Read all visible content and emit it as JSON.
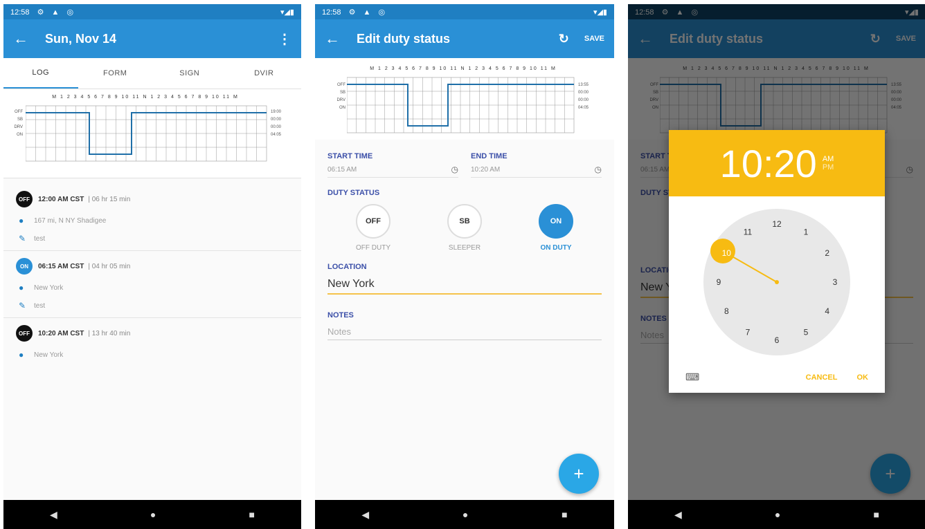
{
  "status_bar": {
    "time": "12:58",
    "icons_left": [
      "⚙",
      "▲",
      "◎"
    ],
    "icons_right": "▾◢▮"
  },
  "screen1": {
    "title": "Sun, Nov 14",
    "tabs": [
      {
        "label": "LOG",
        "active": true
      },
      {
        "label": "FORM",
        "active": false
      },
      {
        "label": "SIGN",
        "active": false
      },
      {
        "label": "DVIR",
        "active": false
      }
    ],
    "grid": {
      "hours": "M 1 2 3 4 5 6 7 8 9 10 11 N 1 2 3 4 5 6 7 8 9 10 11 M",
      "rows": [
        "OFF",
        "SB",
        "DRV",
        "ON"
      ],
      "totals": [
        "19:00",
        "00:00",
        "00:00",
        "04:05"
      ]
    },
    "entries": [
      {
        "status": "OFF",
        "time": "12:00 AM CST",
        "duration": "| 06 hr 15 min",
        "location": "167 mi, N NY Shadigee",
        "note": "test"
      },
      {
        "status": "ON",
        "time": "06:15 AM CST",
        "duration": "| 04 hr 05 min",
        "location": "New York",
        "note": "test"
      },
      {
        "status": "OFF",
        "time": "10:20 AM CST",
        "duration": "| 13 hr 40 min",
        "location": "New York",
        "note": ""
      }
    ]
  },
  "screen2": {
    "title": "Edit duty status",
    "save_label": "SAVE",
    "grid": {
      "hours": "M 1 2 3 4 5 6 7 8 9 10 11 N 1 2 3 4 5 6 7 8 9 10 11 M",
      "rows": [
        "OFF",
        "SB",
        "DRV",
        "ON"
      ],
      "totals": [
        "13:55",
        "00:00",
        "00:00",
        "04:05"
      ]
    },
    "start_time_label": "START TIME",
    "start_time_value": "06:15 AM",
    "end_time_label": "END TIME",
    "end_time_value": "10:20 AM",
    "duty_status_label": "DUTY STATUS",
    "duty_options": [
      {
        "code": "OFF",
        "label": "OFF DUTY",
        "selected": false
      },
      {
        "code": "SB",
        "label": "SLEEPER",
        "selected": false
      },
      {
        "code": "ON",
        "label": "ON DUTY",
        "selected": true
      }
    ],
    "location_label": "LOCATION",
    "location_value": "New York",
    "notes_label": "NOTES",
    "notes_placeholder": "Notes",
    "fab_label": "+"
  },
  "screen3": {
    "time_display": "10:20",
    "am": "AM",
    "pm": "PM",
    "dial_numbers": [
      "12",
      "1",
      "2",
      "3",
      "4",
      "5",
      "6",
      "7",
      "8",
      "9",
      "10",
      "11"
    ],
    "selected_hour": "10",
    "cancel_label": "CANCEL",
    "ok_label": "OK",
    "keyboard_icon": "⌨"
  },
  "nav": {
    "back": "◀",
    "home": "●",
    "recent": "■"
  },
  "colors": {
    "primary": "#2a90d6",
    "status_bar": "#1f7fc2",
    "accent": "#f7bb12",
    "line": "#1f6fa8"
  }
}
